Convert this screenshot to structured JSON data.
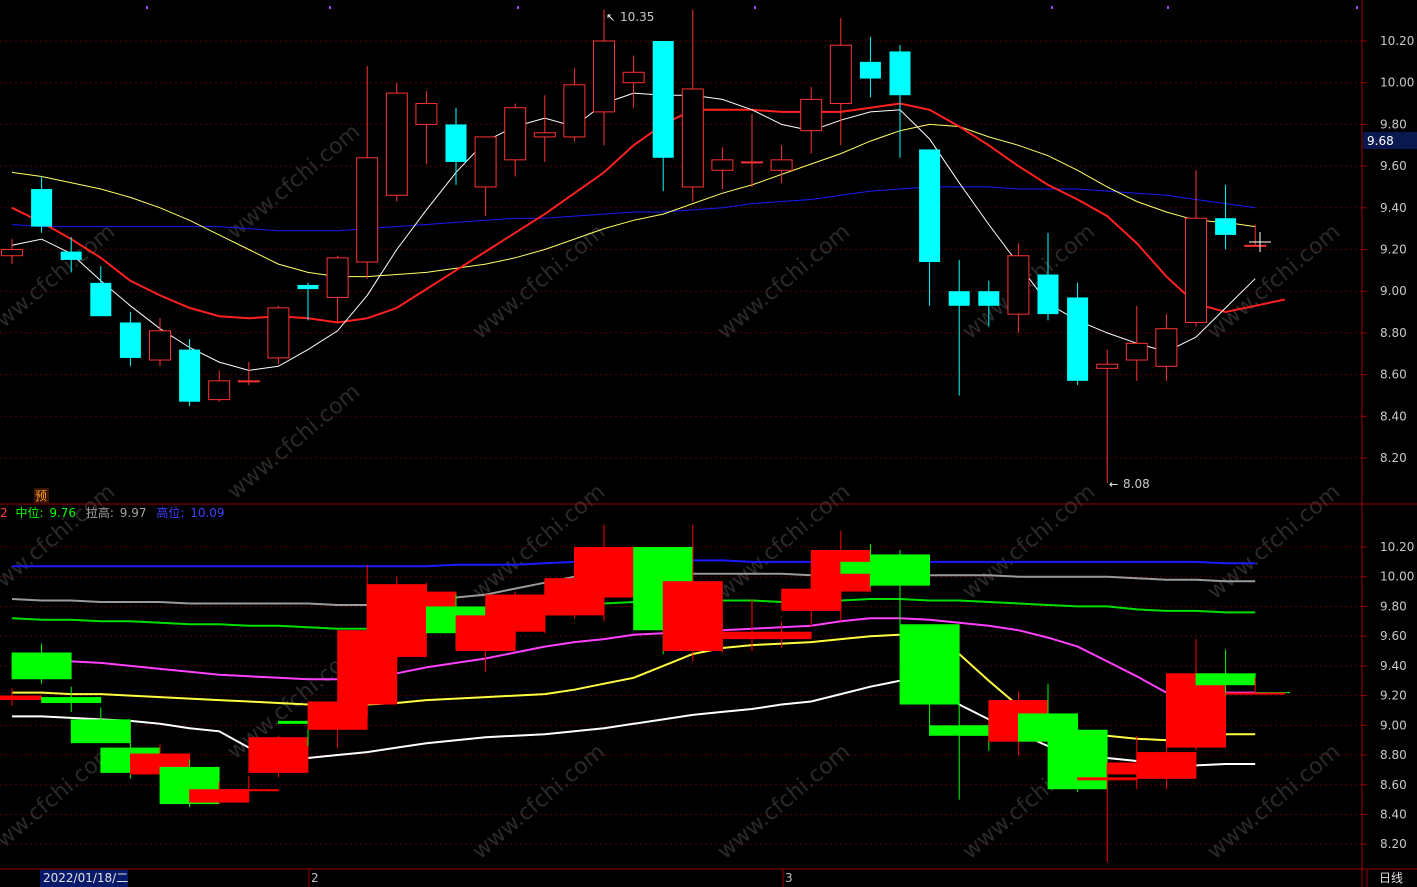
{
  "colors": {
    "background": "#000000",
    "grid": "#5a0000",
    "border": "#a00000",
    "up_candle": "#ff3232",
    "down_candle": "#00ffff",
    "ind_up": "#ff0000",
    "ind_down": "#00ff00",
    "ma5": "#ffffff",
    "ma10": "#ff2020",
    "ma20": "#ffff66",
    "ma60": "#1a1aff"
  },
  "top_panel": {
    "y_ticks": [
      "10.20",
      "10.00",
      "9.80",
      "9.60",
      "9.40",
      "9.20",
      "9.00",
      "8.80",
      "8.60",
      "8.40",
      "8.20"
    ],
    "current_price_tag": "9.68",
    "high_annotation": "10.35",
    "low_annotation": "8.08",
    "badge": "预"
  },
  "indicator_panel": {
    "legend": {
      "prefix": "2",
      "mid_label": "中位:",
      "mid_value": "9.76",
      "pull_label": "拉高:",
      "pull_value": "9.97",
      "high_label": "高位:",
      "high_value": "10.09"
    },
    "y_ticks": [
      "10.20",
      "10.00",
      "9.80",
      "9.60",
      "9.40",
      "9.20",
      "9.00",
      "8.80",
      "8.60",
      "8.40",
      "8.20"
    ]
  },
  "bottom_bar": {
    "date": "2022/01/18/二",
    "month_2": "2",
    "month_3": "3",
    "period": "日线"
  },
  "watermark": "www.cfchi.com",
  "chart_data": {
    "type": "candlestick",
    "ylim": [
      8.0,
      10.4
    ],
    "candles": [
      {
        "o": 9.17,
        "h": 9.25,
        "l": 9.13,
        "c": 9.2
      },
      {
        "o": 9.49,
        "h": 9.55,
        "l": 9.28,
        "c": 9.31
      },
      {
        "o": 9.19,
        "h": 9.26,
        "l": 9.09,
        "c": 9.15
      },
      {
        "o": 9.04,
        "h": 9.12,
        "l": 8.9,
        "c": 8.88
      },
      {
        "o": 8.85,
        "h": 8.9,
        "l": 8.64,
        "c": 8.68
      },
      {
        "o": 8.67,
        "h": 8.87,
        "l": 8.64,
        "c": 8.81
      },
      {
        "o": 8.72,
        "h": 8.77,
        "l": 8.45,
        "c": 8.47
      },
      {
        "o": 8.48,
        "h": 8.62,
        "l": 8.47,
        "c": 8.57
      },
      {
        "o": 8.57,
        "h": 8.66,
        "l": 8.55,
        "c": 8.57
      },
      {
        "o": 8.68,
        "h": 8.93,
        "l": 8.65,
        "c": 8.92
      },
      {
        "o": 9.03,
        "h": 9.04,
        "l": 8.86,
        "c": 9.01
      },
      {
        "o": 8.97,
        "h": 9.17,
        "l": 8.85,
        "c": 9.16
      },
      {
        "o": 9.14,
        "h": 10.08,
        "l": 9.06,
        "c": 9.64
      },
      {
        "o": 9.46,
        "h": 10.0,
        "l": 9.43,
        "c": 9.95
      },
      {
        "o": 9.8,
        "h": 9.96,
        "l": 9.61,
        "c": 9.9
      },
      {
        "o": 9.8,
        "h": 9.88,
        "l": 9.51,
        "c": 9.62
      },
      {
        "o": 9.5,
        "h": 9.71,
        "l": 9.36,
        "c": 9.74
      },
      {
        "o": 9.63,
        "h": 9.9,
        "l": 9.55,
        "c": 9.88
      },
      {
        "o": 9.74,
        "h": 9.94,
        "l": 9.62,
        "c": 9.76
      },
      {
        "o": 9.74,
        "h": 10.07,
        "l": 9.72,
        "c": 9.99
      },
      {
        "o": 9.86,
        "h": 10.35,
        "l": 9.7,
        "c": 10.2
      },
      {
        "o": 10.0,
        "h": 10.13,
        "l": 9.88,
        "c": 10.05
      },
      {
        "o": 10.2,
        "h": 10.2,
        "l": 9.48,
        "c": 9.64
      },
      {
        "o": 9.5,
        "h": 10.35,
        "l": 9.43,
        "c": 9.97
      },
      {
        "o": 9.58,
        "h": 9.69,
        "l": 9.49,
        "c": 9.63
      },
      {
        "o": 9.62,
        "h": 9.85,
        "l": 9.5,
        "c": 9.62
      },
      {
        "o": 9.58,
        "h": 9.7,
        "l": 9.52,
        "c": 9.63
      },
      {
        "o": 9.77,
        "h": 9.98,
        "l": 9.66,
        "c": 9.92
      },
      {
        "o": 9.9,
        "h": 10.31,
        "l": 9.7,
        "c": 10.18
      },
      {
        "o": 10.1,
        "h": 10.22,
        "l": 9.93,
        "c": 10.02
      },
      {
        "o": 10.15,
        "h": 10.18,
        "l": 9.64,
        "c": 9.94
      },
      {
        "o": 9.68,
        "h": 9.68,
        "l": 8.93,
        "c": 9.14
      },
      {
        "o": 9.0,
        "h": 9.15,
        "l": 8.5,
        "c": 8.93
      },
      {
        "o": 9.0,
        "h": 9.05,
        "l": 8.83,
        "c": 8.93
      },
      {
        "o": 8.89,
        "h": 9.23,
        "l": 8.8,
        "c": 9.17
      },
      {
        "o": 9.08,
        "h": 9.28,
        "l": 8.86,
        "c": 8.89
      },
      {
        "o": 8.97,
        "h": 9.04,
        "l": 8.55,
        "c": 8.57
      },
      {
        "o": 8.63,
        "h": 8.72,
        "l": 8.08,
        "c": 8.65
      },
      {
        "o": 8.67,
        "h": 8.93,
        "l": 8.57,
        "c": 8.75
      },
      {
        "o": 8.64,
        "h": 8.89,
        "l": 8.57,
        "c": 8.82
      },
      {
        "o": 8.85,
        "h": 9.58,
        "l": 8.83,
        "c": 9.35
      },
      {
        "o": 9.35,
        "h": 9.51,
        "l": 9.2,
        "c": 9.27
      },
      {
        "o": 9.22,
        "h": 9.32,
        "l": 9.22,
        "c": 9.22
      }
    ],
    "ma5": [
      9.22,
      9.25,
      9.18,
      9.05,
      8.93,
      8.82,
      8.73,
      8.66,
      8.62,
      8.64,
      8.72,
      8.81,
      8.98,
      9.2,
      9.39,
      9.57,
      9.72,
      9.79,
      9.83,
      9.79,
      9.9,
      9.95,
      9.94,
      9.94,
      9.92,
      9.87,
      9.8,
      9.77,
      9.82,
      9.86,
      9.87,
      9.73,
      9.52,
      9.32,
      9.13,
      8.94,
      8.86,
      8.8,
      8.75,
      8.71,
      8.78,
      8.92,
      9.06
    ],
    "ma10": [
      9.4,
      9.33,
      9.25,
      9.16,
      9.05,
      8.98,
      8.92,
      8.88,
      8.87,
      8.88,
      8.87,
      8.85,
      8.87,
      8.92,
      9.01,
      9.1,
      9.19,
      9.28,
      9.37,
      9.47,
      9.57,
      9.7,
      9.8,
      9.87,
      9.87,
      9.87,
      9.86,
      9.86,
      9.86,
      9.88,
      9.9,
      9.87,
      9.79,
      9.7,
      9.6,
      9.51,
      9.44,
      9.36,
      9.23,
      9.07,
      8.94,
      8.9,
      8.93,
      8.96
    ],
    "ma20": [
      9.57,
      9.55,
      9.52,
      9.49,
      9.45,
      9.4,
      9.34,
      9.27,
      9.2,
      9.13,
      9.09,
      9.07,
      9.07,
      9.08,
      9.09,
      9.11,
      9.13,
      9.16,
      9.2,
      9.25,
      9.3,
      9.34,
      9.37,
      9.42,
      9.47,
      9.51,
      9.56,
      9.61,
      9.66,
      9.72,
      9.77,
      9.8,
      9.79,
      9.74,
      9.7,
      9.65,
      9.58,
      9.5,
      9.43,
      9.38,
      9.34,
      9.33,
      9.31
    ],
    "ma60": [
      9.32,
      9.31,
      9.31,
      9.31,
      9.31,
      9.31,
      9.31,
      9.31,
      9.3,
      9.29,
      9.29,
      9.29,
      9.3,
      9.31,
      9.32,
      9.33,
      9.34,
      9.35,
      9.35,
      9.36,
      9.37,
      9.38,
      9.38,
      9.39,
      9.4,
      9.42,
      9.43,
      9.44,
      9.46,
      9.48,
      9.49,
      9.5,
      9.5,
      9.5,
      9.49,
      9.49,
      9.49,
      9.48,
      9.47,
      9.46,
      9.44,
      9.42,
      9.4
    ],
    "indicator": {
      "ylim": [
        8.1,
        10.35
      ],
      "high_line": [
        10.07,
        10.07,
        10.07,
        10.07,
        10.07,
        10.07,
        10.07,
        10.07,
        10.07,
        10.07,
        10.07,
        10.07,
        10.07,
        10.07,
        10.07,
        10.08,
        10.08,
        10.08,
        10.09,
        10.1,
        10.1,
        10.11,
        10.11,
        10.11,
        10.11,
        10.1,
        10.1,
        10.1,
        10.1,
        10.1,
        10.1,
        10.1,
        10.1,
        10.1,
        10.1,
        10.1,
        10.1,
        10.1,
        10.1,
        10.1,
        10.1,
        10.09,
        10.09
      ],
      "pull_line": [
        9.85,
        9.84,
        9.84,
        9.83,
        9.83,
        9.83,
        9.82,
        9.82,
        9.82,
        9.82,
        9.82,
        9.81,
        9.81,
        9.83,
        9.85,
        9.86,
        9.88,
        9.92,
        9.96,
        10.0,
        10.02,
        10.02,
        10.02,
        10.02,
        10.02,
        10.02,
        10.02,
        10.01,
        10.01,
        10.01,
        10.01,
        10.01,
        10.01,
        10.01,
        10.0,
        10.0,
        10.0,
        10.0,
        9.99,
        9.98,
        9.98,
        9.97,
        9.97
      ],
      "mid_line": [
        9.72,
        9.71,
        9.71,
        9.7,
        9.7,
        9.69,
        9.68,
        9.68,
        9.67,
        9.67,
        9.66,
        9.65,
        9.65,
        9.69,
        9.73,
        9.75,
        9.76,
        9.77,
        9.78,
        9.8,
        9.82,
        9.83,
        9.84,
        9.84,
        9.84,
        9.84,
        9.83,
        9.83,
        9.84,
        9.85,
        9.85,
        9.84,
        9.84,
        9.83,
        9.82,
        9.81,
        9.8,
        9.8,
        9.78,
        9.77,
        9.77,
        9.76,
        9.76
      ],
      "pink_line": [
        9.45,
        9.44,
        9.43,
        9.42,
        9.4,
        9.38,
        9.36,
        9.34,
        9.33,
        9.32,
        9.31,
        9.31,
        9.32,
        9.35,
        9.39,
        9.42,
        9.45,
        9.49,
        9.53,
        9.56,
        9.58,
        9.61,
        9.62,
        9.63,
        9.64,
        9.65,
        9.66,
        9.67,
        9.7,
        9.72,
        9.72,
        9.71,
        9.69,
        9.67,
        9.64,
        9.59,
        9.53,
        9.43,
        9.33,
        9.22,
        9.22,
        9.22,
        9.22
      ],
      "yellow_line": [
        9.22,
        9.22,
        9.21,
        9.21,
        9.2,
        9.19,
        9.18,
        9.17,
        9.16,
        9.15,
        9.14,
        9.14,
        9.14,
        9.15,
        9.17,
        9.18,
        9.19,
        9.2,
        9.21,
        9.24,
        9.28,
        9.32,
        9.4,
        9.48,
        9.52,
        9.54,
        9.55,
        9.56,
        9.58,
        9.6,
        9.61,
        9.61,
        9.48,
        9.3,
        9.13,
        9.03,
        8.96,
        8.93,
        8.91,
        8.9,
        8.94,
        8.94,
        8.94
      ],
      "white_line": [
        9.06,
        9.06,
        9.05,
        9.04,
        9.03,
        9.01,
        8.98,
        8.96,
        8.85,
        8.78,
        8.78,
        8.8,
        8.82,
        8.85,
        8.88,
        8.9,
        8.92,
        8.93,
        8.94,
        8.96,
        8.98,
        9.01,
        9.04,
        9.07,
        9.09,
        9.11,
        9.14,
        9.16,
        9.21,
        9.26,
        9.3,
        9.3,
        9.14,
        9.04,
        8.95,
        8.86,
        8.8,
        8.78,
        8.76,
        8.73,
        8.73,
        8.74,
        8.74
      ]
    }
  }
}
